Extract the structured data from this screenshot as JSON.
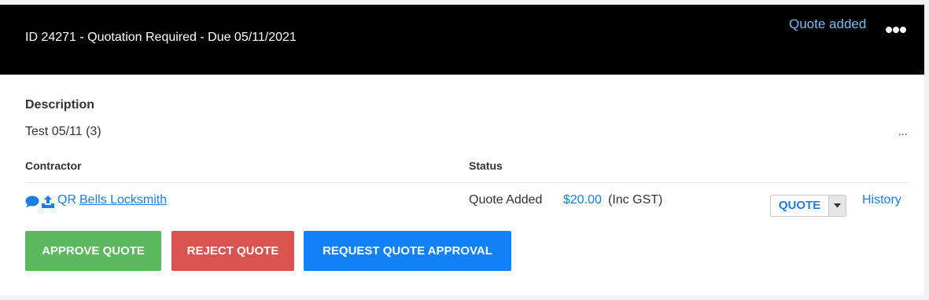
{
  "header": {
    "title": "ID 24271 - Quotation Required - Due 05/11/2021",
    "status": "Quote added",
    "more_icon": "more-horizontal-icon"
  },
  "description": {
    "label": "Description",
    "text": "Test 05/11 (3)",
    "ellipsis": "..."
  },
  "table": {
    "headers": {
      "contractor": "Contractor",
      "status": "Status"
    },
    "row": {
      "icons": [
        "chat-icon",
        "upload-icon"
      ],
      "prefix": "QR",
      "contractor_name": "Bells Locksmith",
      "status": "Quote Added",
      "amount": "$20.00",
      "tax_note": "(Inc GST)",
      "select_value": "QUOTE",
      "history_label": "History"
    }
  },
  "actions": {
    "approve": "APPROVE QUOTE",
    "reject": "REJECT QUOTE",
    "request": "REQUEST QUOTE APPROVAL"
  },
  "colors": {
    "header_bg": "#000000",
    "link": "#1a7fe0",
    "approve": "#5cb85c",
    "reject": "#d9534f",
    "request": "#1280f6"
  }
}
